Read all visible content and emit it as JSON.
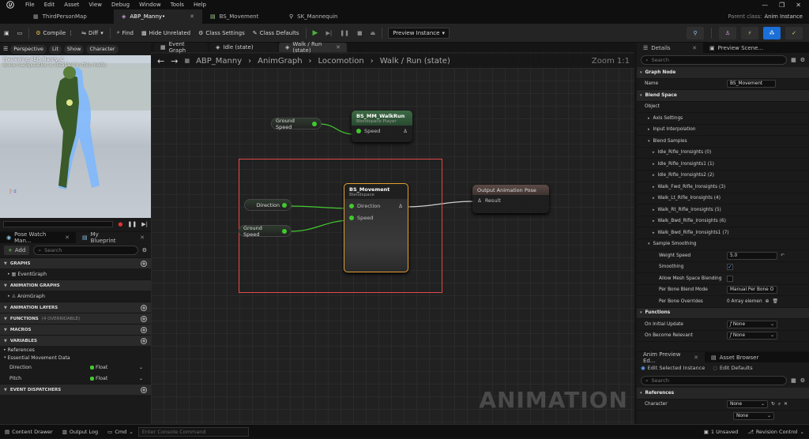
{
  "menu": [
    "File",
    "Edit",
    "Asset",
    "View",
    "Debug",
    "Window",
    "Tools",
    "Help"
  ],
  "doc_tabs": [
    {
      "label": "ThirdPersonMap",
      "icon": "level-icon"
    },
    {
      "label": "ABP_Manny•",
      "icon": "anim-blueprint-icon"
    },
    {
      "label": "BS_Movement",
      "icon": "blendspace-icon"
    },
    {
      "label": "SK_Mannequin",
      "icon": "skeleton-icon"
    }
  ],
  "parent_class": {
    "label": "Parent class:",
    "value": "Anim Instance"
  },
  "toolbar": {
    "compile": "Compile",
    "diff": "Diff",
    "find": "Find",
    "hide_unrelated": "Hide Unrelated",
    "class_settings": "Class Settings",
    "class_defaults": "Class Defaults",
    "preview_instance": "Preview Instance"
  },
  "viewport": {
    "buttons": [
      "Perspective",
      "Lit",
      "Show",
      "Character"
    ],
    "overlay_line1": "Previewing ABP_Manny_C",
    "overlay_line2": "Bone manipulation is disabled in this mode."
  },
  "mybp": {
    "tabs": [
      "Pose Watch Man...",
      "My Blueprint"
    ],
    "add": "Add",
    "search_placeholder": "Search",
    "sections": {
      "graphs": "GRAPHS",
      "anim_graphs": "ANIMATION GRAPHS",
      "anim_layers": "ANIMATION LAYERS",
      "functions": "FUNCTIONS",
      "functions_count": "(4 OVERRIDABLE)",
      "macros": "MACROS",
      "variables": "VARIABLES",
      "event_dispatchers": "EVENT DISPATCHERS"
    },
    "event_graph": "EventGraph",
    "anim_graph": "AnimGraph",
    "references": "References",
    "essential": "Essential Movement Data",
    "vars": [
      {
        "name": "Direction",
        "type": "Float"
      },
      {
        "name": "Pitch",
        "type": "Float"
      }
    ]
  },
  "graph": {
    "tabs": [
      "Event Graph",
      "Idle (state)",
      "Walk / Run (state)"
    ],
    "breadcrumb": [
      "ABP_Manny",
      "AnimGraph",
      "Locomotion",
      "Walk / Run (state)"
    ],
    "zoom": "Zoom 1:1",
    "watermark": "ANIMATION",
    "nodes": {
      "ground_speed_top": "Ground Speed",
      "walkrun_title": "BS_MM_WalkRun",
      "walkrun_sub": "Blendspace Player",
      "walkrun_pin": "Speed",
      "direction": "Direction",
      "ground_speed": "Ground Speed",
      "bs_title": "BS_Movement",
      "bs_sub": "Blendspace",
      "bs_pin1": "Direction",
      "bs_pin2": "Speed",
      "output_title": "Output Animation Pose",
      "output_pin": "Result"
    }
  },
  "details": {
    "tabs": [
      "Details",
      "Preview Scene..."
    ],
    "search_placeholder": "Search",
    "graph_node": "Graph Node",
    "name_label": "Name",
    "name_value": "BS_Movement",
    "blend_space": "Blend Space",
    "object": "Object",
    "axis_settings": "Axis Settings",
    "input_interp": "Input Interpolation",
    "blend_samples": "Blend Samples",
    "samples": [
      "Idle_Rifle_Ironsights (0)",
      "Idle_Rifle_Ironsights1 (1)",
      "Idle_Rifle_Ironsights2 (2)",
      "Walk_Fwd_Rifle_Ironsights (3)",
      "Walk_Lt_Rifle_Ironsights (4)",
      "Walk_Rt_Rifle_Ironsights (5)",
      "Walk_Bwd_Rifle_Ironsights (6)",
      "Walk_Bwd_Rifle_Ironsights1 (7)"
    ],
    "sample_smoothing": "Sample Smoothing",
    "weight_speed": "Weight Speed",
    "weight_speed_value": "5.0",
    "smoothing": "Smoothing",
    "allow_mesh": "Allow Mesh Space Blending",
    "per_bone_mode": "Per Bone Blend Mode",
    "per_bone_mode_value": "Manual Per Bone O",
    "per_bone_overrides": "Per Bone Overrides",
    "per_bone_overrides_value": "0 Array elemen",
    "functions": "Functions",
    "on_initial": "On Initial Update",
    "on_relevant": "On Become Relevant",
    "none": "None"
  },
  "anim_preview": {
    "tabs": [
      "Anim Preview Ed...",
      "Asset Browser"
    ],
    "edit_selected": "Edit Selected Instance",
    "edit_defaults": "Edit Defaults",
    "search_placeholder": "Search",
    "references": "References",
    "character": "Character",
    "none": "None"
  },
  "statusbar": {
    "content_drawer": "Content Drawer",
    "output_log": "Output Log",
    "cmd": "Cmd",
    "console_placeholder": "Enter Console Command",
    "unsaved": "1 Unsaved",
    "revision": "Revision Control"
  }
}
